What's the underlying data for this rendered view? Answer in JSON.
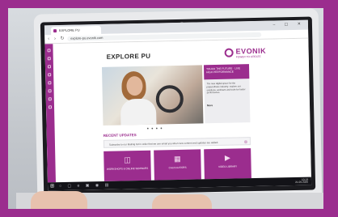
{
  "browser": {
    "tab_title": "EXPLORE PU",
    "url": "explore-pu.evonik.com",
    "nav_glyphs": "‹ › ↻",
    "window_buttons": "– ▢ ✕"
  },
  "header": {
    "site_logo": "EXPLORE PU",
    "brand_logo": "EVONIK",
    "brand_tagline": "POWER TO CREATE"
  },
  "promo": {
    "heading": "TOUCH THE FUTURE · LIVE HIGH PERFORMANCE",
    "body": "The new digital space for the polyurethane industry: explore our solutions, webinars and tools for better performance.",
    "link_label": "More"
  },
  "carousel": {
    "dots": "● ● ● ●"
  },
  "recent": {
    "title": "RECENT UPDATES",
    "notice": "Subscribe to our Mailing list in order that we can email you when new content and updates are added."
  },
  "tiles": [
    {
      "icon": "book-icon",
      "glyph": "◫",
      "label": "WORKSHOPS & ONLINE SEMINARS"
    },
    {
      "icon": "calculator-icon",
      "glyph": "▦",
      "label": "CALCULATORS"
    },
    {
      "icon": "video-icon",
      "glyph": "▶",
      "label": "VIDEO LIBRARY"
    }
  ],
  "taskbar": {
    "start_glyph": "⊞",
    "icons": "○ ▢ e ▣ ◉ ▤",
    "time": "10:19",
    "date": "21.09.2020"
  },
  "colors": {
    "brand_purple": "#9b2d8e",
    "frame_purple": "#9b2d8e"
  }
}
